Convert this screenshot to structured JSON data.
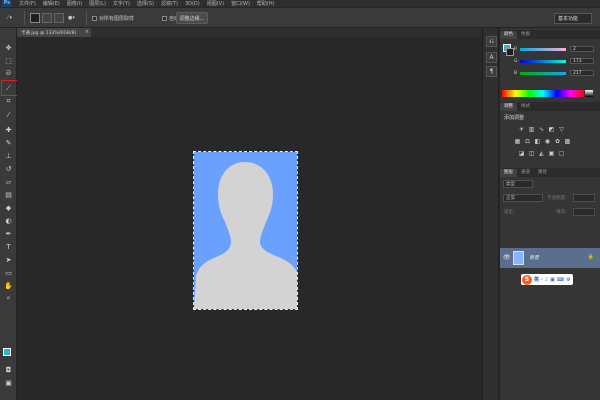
{
  "app": {
    "logo": "Ps"
  },
  "menu": [
    "文件(F)",
    "编辑(E)",
    "图像(I)",
    "图层(L)",
    "文字(Y)",
    "选择(S)",
    "滤镜(T)",
    "3D(D)",
    "视图(V)",
    "窗口(W)",
    "帮助(H)"
  ],
  "options": {
    "checkbox_label": "对所有图层取样",
    "auto_enhance": "自动增强",
    "refine_button": "调整边缘...",
    "workspace": "基本功能"
  },
  "document_tab": {
    "label": "卡通.jpg @ 133%(RGB/8)",
    "close": "×"
  },
  "color_panel": {
    "tabs": [
      "颜色",
      "色板"
    ],
    "sliders": [
      {
        "label": "R",
        "value": "2"
      },
      {
        "label": "G",
        "value": "173"
      },
      {
        "label": "B",
        "value": "217"
      }
    ],
    "foreground_hex": "#02ADD9"
  },
  "adjustments_panel": {
    "tabs": [
      "调整",
      "样式"
    ],
    "title": "添加调整"
  },
  "layers_panel": {
    "tabs": [
      "图层",
      "通道",
      "路径"
    ],
    "kind_label": "类型",
    "blend_mode": "正常",
    "opacity_label": "不透明度:",
    "lock_label": "锁定:",
    "fill_label": "填充:",
    "layer_name": "背景"
  },
  "ime": {
    "logo": "S",
    "items": [
      "英",
      "·",
      "♪",
      "▣",
      "⌨",
      "⚙"
    ]
  },
  "icons": {
    "move": "move-icon",
    "marquee": "marquee-icon",
    "lasso": "lasso-icon",
    "quick_select": "quick-selection-icon"
  },
  "colors": {
    "canvas_bg": "#282828",
    "photo_bg": "#6aa1ff",
    "silhouette": "#d3d3d3",
    "highlight": "#e02020"
  }
}
